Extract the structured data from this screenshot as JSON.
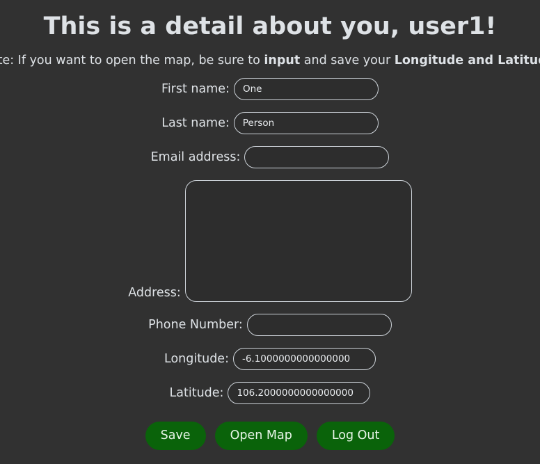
{
  "page": {
    "title": "This is a detail about you, user1!",
    "note": {
      "prefix": "Note: If you want to open the map, be sure to ",
      "bold1": "input",
      "middle": " and save your ",
      "bold2": "Longitude and Latitude",
      "suffix": "."
    }
  },
  "form": {
    "first_name": {
      "label": "First name:",
      "value": "One",
      "placeholder": ""
    },
    "last_name": {
      "label": "Last name:",
      "value": "Person",
      "placeholder": ""
    },
    "email": {
      "label": "Email address:",
      "value": "",
      "placeholder": ""
    },
    "address": {
      "label": "Address:",
      "value": "",
      "placeholder": ""
    },
    "phone": {
      "label": "Phone Number:",
      "value": "",
      "placeholder": ""
    },
    "longitude": {
      "label": "Longitude:",
      "value": "-6.1000000000000000",
      "placeholder": ""
    },
    "latitude": {
      "label": "Latitude:",
      "value": "106.2000000000000000",
      "placeholder": ""
    }
  },
  "buttons": {
    "save": "Save",
    "open_map": "Open Map",
    "log_out": "Log Out"
  },
  "colors": {
    "background": "#313131",
    "text": "#dee2e6",
    "input_border": "#ced4da",
    "input_background": "#2d2d2d",
    "button_green": "#0a630a",
    "button_text": "#e8f5e8"
  }
}
